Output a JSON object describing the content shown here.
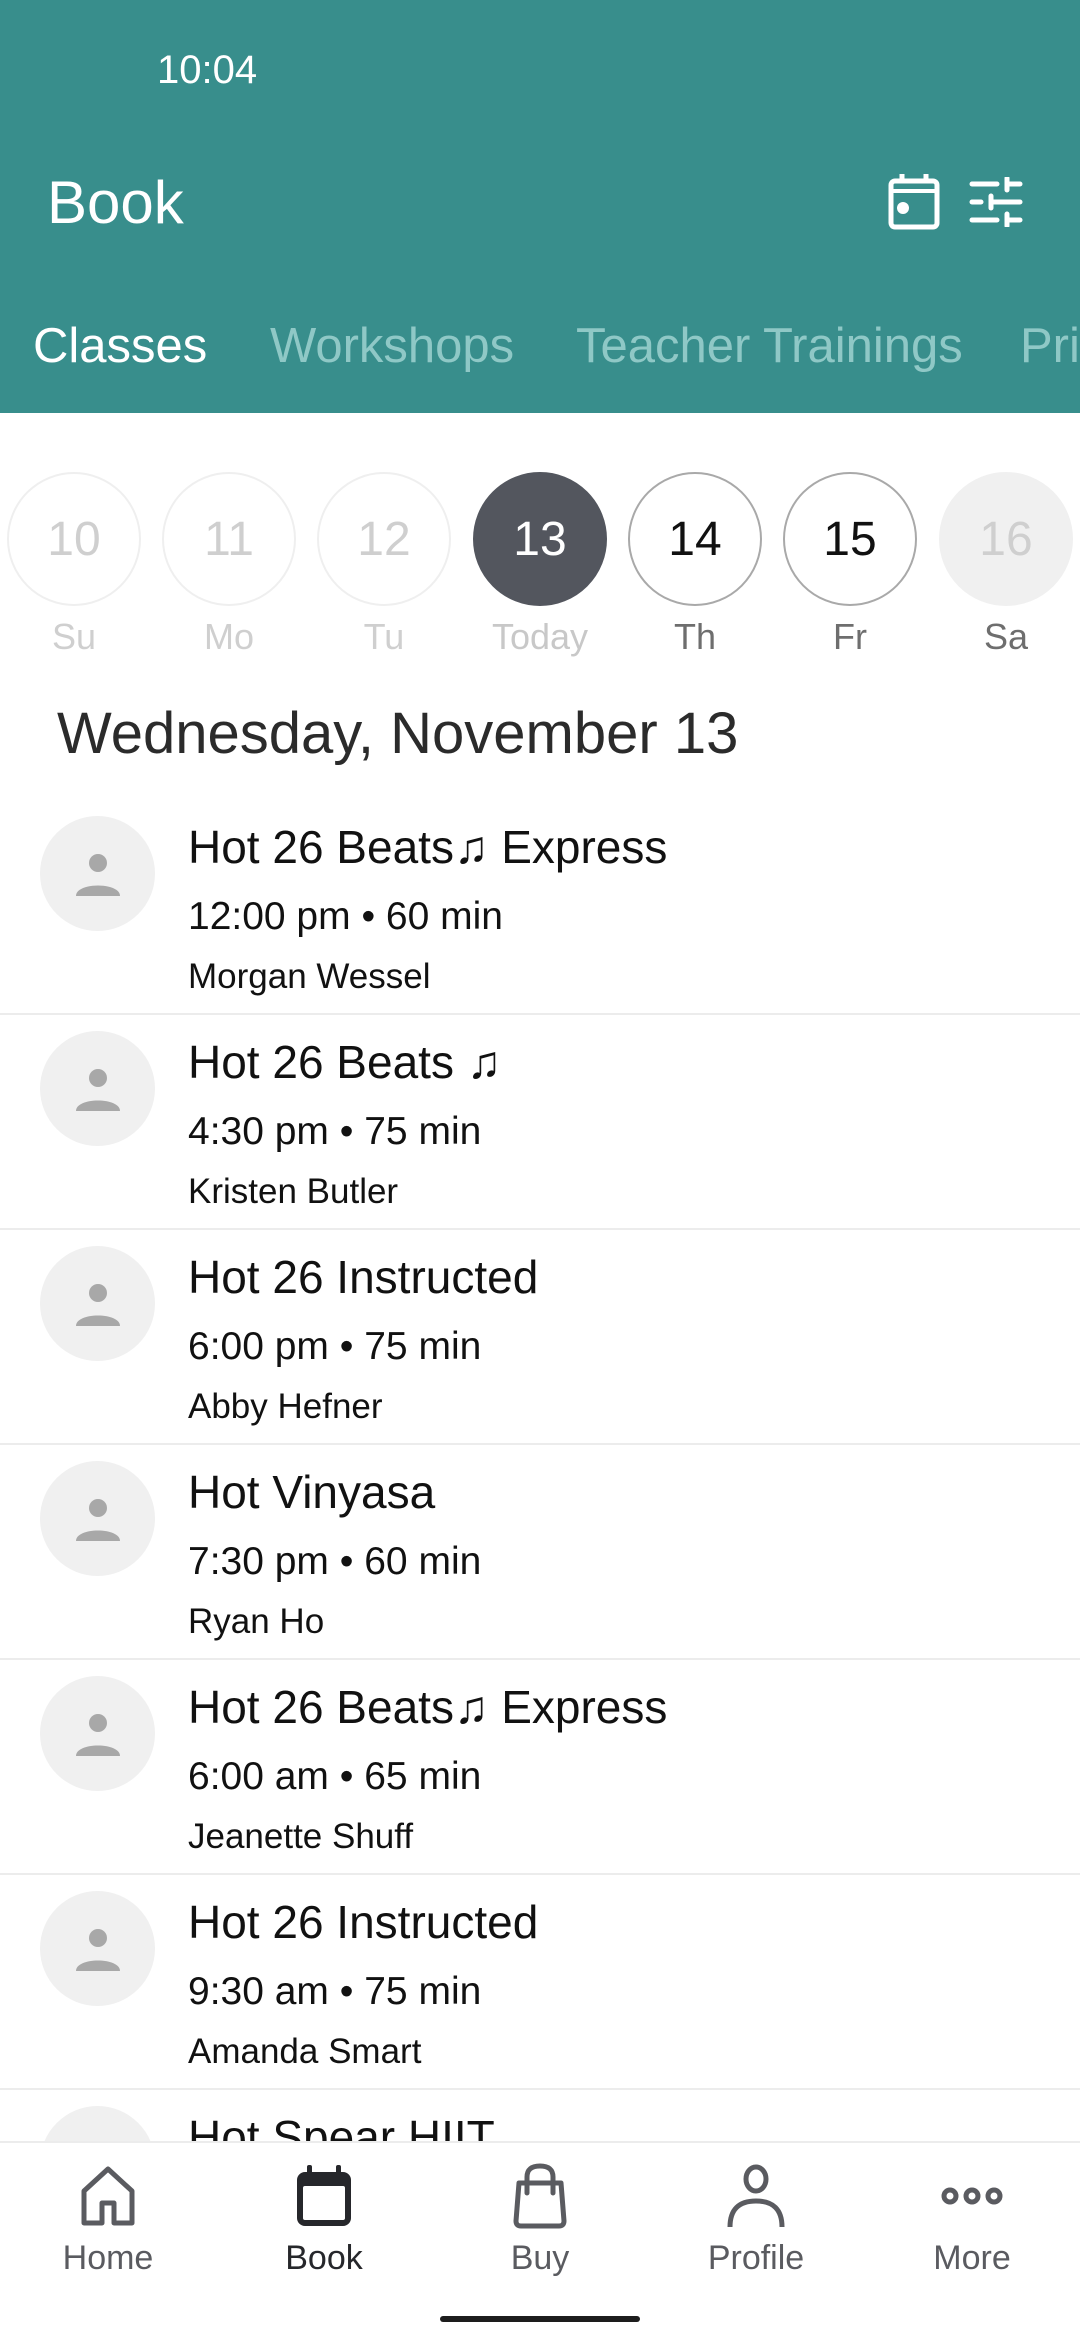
{
  "status_bar": {
    "time": "10:04"
  },
  "header": {
    "title": "Book",
    "calendar_icon": "calendar-icon",
    "filter_icon": "sliders-filter-icon",
    "color": "#388e8c"
  },
  "tabs": [
    {
      "label": "Classes",
      "active": true
    },
    {
      "label": "Workshops",
      "active": false
    },
    {
      "label": "Teacher Trainings",
      "active": false
    },
    {
      "label": "Pri",
      "active": false
    }
  ],
  "days": [
    {
      "num": "10",
      "dow": "Su",
      "state": "past"
    },
    {
      "num": "11",
      "dow": "Mo",
      "state": "past"
    },
    {
      "num": "12",
      "dow": "Tu",
      "state": "past"
    },
    {
      "num": "13",
      "dow": "Today",
      "state": "today"
    },
    {
      "num": "14",
      "dow": "Th",
      "state": "future"
    },
    {
      "num": "15",
      "dow": "Fr",
      "state": "future"
    },
    {
      "num": "16",
      "dow": "Sa",
      "state": "disabled"
    }
  ],
  "date_heading": "Wednesday, November 13",
  "classes": [
    {
      "name": "Hot 26 Beats♫ Express",
      "time": "12:00 pm • 60 min",
      "teacher": "Morgan Wessel"
    },
    {
      "name": "Hot 26 Beats ♫",
      "time": "4:30 pm • 75 min",
      "teacher": "Kristen Butler"
    },
    {
      "name": "Hot 26 Instructed",
      "time": "6:00 pm • 75 min",
      "teacher": "Abby Hefner"
    },
    {
      "name": "Hot Vinyasa",
      "time": "7:30 pm • 60 min",
      "teacher": "Ryan Ho"
    },
    {
      "name": "Hot 26 Beats♫ Express",
      "time": "6:00 am • 65 min",
      "teacher": "Jeanette Shuff"
    },
    {
      "name": "Hot 26 Instructed",
      "time": "9:30 am • 75 min",
      "teacher": "Amanda Smart"
    },
    {
      "name": "Hot Spear HIIT",
      "time": "",
      "teacher": ""
    }
  ],
  "bottom_nav": [
    {
      "label": "Home",
      "icon": "home-icon",
      "active": false
    },
    {
      "label": "Book",
      "icon": "calendar-icon",
      "active": true
    },
    {
      "label": "Buy",
      "icon": "shopping-bag-icon",
      "active": false
    },
    {
      "label": "Profile",
      "icon": "person-icon",
      "active": false
    },
    {
      "label": "More",
      "icon": "more-dots-icon",
      "active": false
    }
  ]
}
